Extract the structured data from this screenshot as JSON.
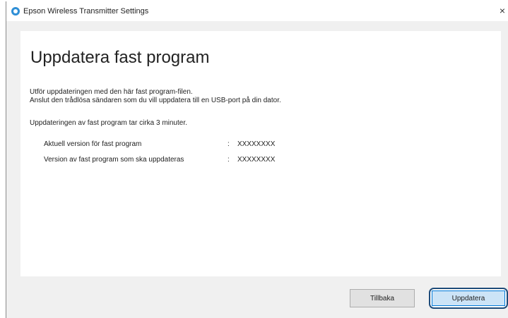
{
  "window": {
    "title": "Epson Wireless Transmitter Settings",
    "close_glyph": "×"
  },
  "main": {
    "heading": "Uppdatera fast program",
    "lines": [
      "Utför uppdateringen med den här fast program-filen.",
      "Anslut den trådlösa sändaren som du vill uppdatera till en USB-port på din dator.",
      "Uppdateringen av fast program tar cirka 3 minuter."
    ],
    "versions": [
      {
        "label": "Aktuell version för fast program",
        "colon": ":",
        "value": "XXXXXXXX"
      },
      {
        "label": "Version av fast program som ska uppdateras",
        "colon": ":",
        "value": "XXXXXXXX"
      }
    ]
  },
  "buttons": {
    "back": "Tillbaka",
    "update": "Uppdatera"
  },
  "colors": {
    "accent": "#0078d7",
    "highlight_outline": "#1e4c7a"
  }
}
